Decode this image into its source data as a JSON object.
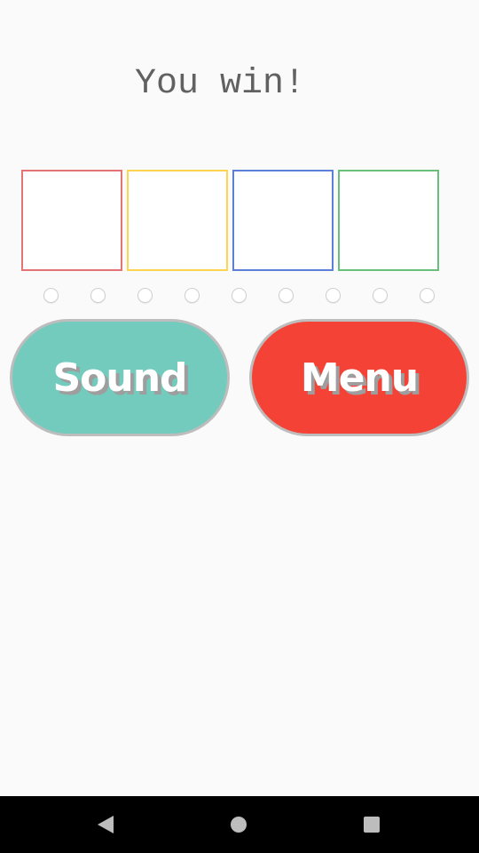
{
  "title": "You win!",
  "boxes": [
    {
      "color": "#e57373"
    },
    {
      "color": "#ffd54f"
    },
    {
      "color": "#5c7fd8"
    },
    {
      "color": "#66c07a"
    }
  ],
  "dots_count": 9,
  "buttons": {
    "sound": {
      "label": "Sound",
      "color": "#72cbbd"
    },
    "menu": {
      "label": "Menu",
      "color": "#f44336"
    }
  },
  "navbar": {
    "back_icon": "back-triangle",
    "home_icon": "home-circle",
    "recents_icon": "recents-square"
  }
}
